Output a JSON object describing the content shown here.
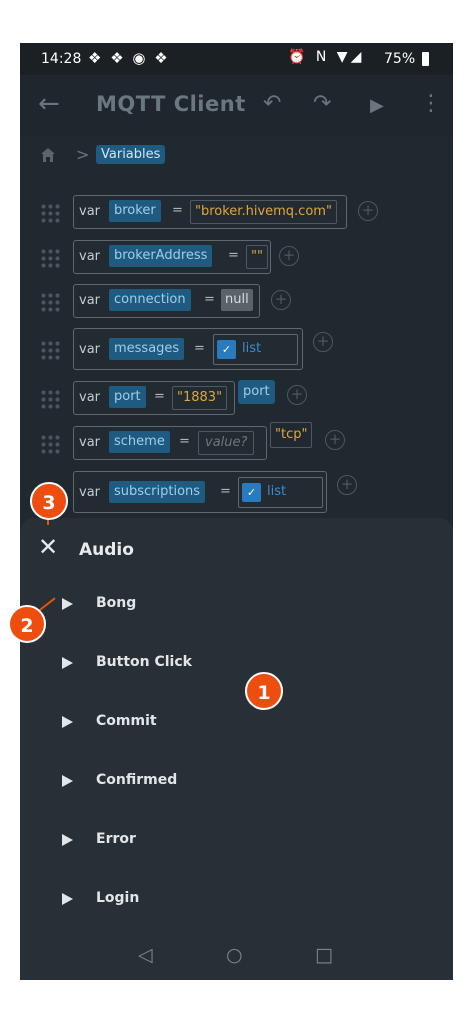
{
  "status_bar": {
    "time": "14:28",
    "left_icons": "❖ ❖ ◉ ❖",
    "right_icons": "⏰ N ▼◢",
    "battery": "75%"
  },
  "app_bar": {
    "title": "MQTT Client",
    "back_glyph": "←",
    "undo_glyph": "↶",
    "redo_glyph": "↷",
    "play_glyph": "▶",
    "more_glyph": "⋮"
  },
  "breadcrumb": {
    "separator": ">",
    "current": "Variables"
  },
  "variables": [
    {
      "kw": "var",
      "name": "broker",
      "eq": "=",
      "value": "\"broker.hivemq.com\"",
      "kind": "string"
    },
    {
      "kw": "var",
      "name": "brokerAddress",
      "eq": "=",
      "value": "\"\"",
      "kind": "string"
    },
    {
      "kw": "var",
      "name": "connection",
      "eq": "=",
      "value": "null",
      "kind": "null"
    },
    {
      "kw": "var",
      "name": "messages",
      "eq": "=",
      "value": "list",
      "kind": "list"
    },
    {
      "kw": "var",
      "name": "port",
      "eq": "=",
      "value": "\"1883\"",
      "kind": "string",
      "extra": "port"
    },
    {
      "kw": "var",
      "name": "scheme",
      "eq": "=",
      "value": "value?",
      "kind": "placeholder",
      "extra": "\"tcp\""
    },
    {
      "kw": "var",
      "name": "subscriptions",
      "eq": "=",
      "value": "list",
      "kind": "list"
    }
  ],
  "sheet": {
    "close_glyph": "✕",
    "title": "Audio",
    "items": [
      "Bong",
      "Button Click",
      "Commit",
      "Confirmed",
      "Error",
      "Login"
    ]
  },
  "nav_bar": {
    "back": "◁",
    "home": "○",
    "recents": "□"
  },
  "callouts": [
    "1",
    "2",
    "3"
  ],
  "colors": {
    "background": "#212930",
    "sheet": "#283037",
    "variable_pill": "#1f5a80",
    "string": "#e0a53c",
    "callout": "#ee4d10"
  }
}
